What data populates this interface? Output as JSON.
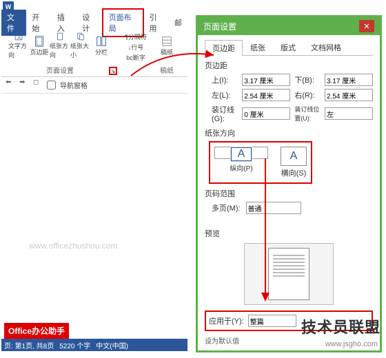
{
  "titlebar": {
    "app_icon": "W"
  },
  "tabs": {
    "file": "文件",
    "home": "开始",
    "insert": "插入",
    "design": "设计",
    "layout": "页面布局",
    "references": "引用",
    "mailings": "邮"
  },
  "ribbon": {
    "text_direction": "文字方向",
    "margins": "页边距",
    "orientation": "纸张方向",
    "size": "纸张大小",
    "columns": "分栏",
    "breaks": "¶分隔符",
    "line_numbers": "↓行号",
    "hyphenation": "bc断字",
    "manuscript": "稿纸",
    "group_page_setup": "页面设置",
    "group_manuscript": "稿纸"
  },
  "qat": {
    "nav_pane": "导航窗格"
  },
  "doc": {
    "watermark": "www.officezhushou.com"
  },
  "badge": {
    "office": "Office办公助手"
  },
  "statusbar": {
    "page": "页: 第1页, 共8页",
    "words": "5220 个字",
    "lang": "中文(中国)"
  },
  "dialog": {
    "title": "页面设置",
    "tabs": {
      "margins": "页边距",
      "paper": "纸张",
      "layout": "版式",
      "grid": "文档网格"
    },
    "section_margins": "页边距",
    "top_label": "上(I):",
    "top_value": "3.17 厘米",
    "bottom_label": "下(B):",
    "bottom_value": "3.17 厘米",
    "left_label": "左(L):",
    "left_value": "2.54 厘米",
    "right_label": "右(R):",
    "right_value": "2.54 厘米",
    "gutter_label": "装订线(G):",
    "gutter_value": "0 厘米",
    "gutter_pos_label": "装订线位置(U):",
    "gutter_pos_value": "左",
    "section_orient": "纸张方向",
    "portrait": "纵向(P)",
    "landscape": "横向(S)",
    "section_pages": "页码范围",
    "multi_label": "多页(M):",
    "multi_value": "普通",
    "section_preview": "预览",
    "apply_label": "应用于(Y):",
    "apply_value": "整篇",
    "set_default": "设为默认值"
  },
  "overlay": {
    "brand": "技术员联盟",
    "url": "www.jsgho.com"
  }
}
